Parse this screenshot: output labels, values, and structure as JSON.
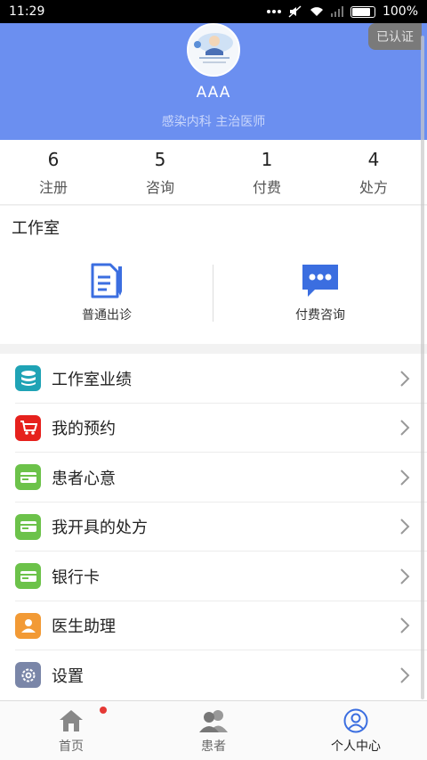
{
  "status_bar": {
    "time": "11:29",
    "battery": "100%"
  },
  "header": {
    "name": "AAA",
    "subtitle": "感染内科  主治医师",
    "verified": "已认证"
  },
  "stats": [
    {
      "num": "6",
      "label": "注册"
    },
    {
      "num": "5",
      "label": "咨询"
    },
    {
      "num": "1",
      "label": "付费"
    },
    {
      "num": "4",
      "label": "处方"
    }
  ],
  "studio": {
    "title": "工作室",
    "actions": [
      {
        "label": "普通出诊",
        "icon": "document-icon"
      },
      {
        "label": "付费咨询",
        "icon": "chat-icon"
      }
    ]
  },
  "menu": [
    {
      "label": "工作室业绩",
      "icon": "database-icon",
      "color": "#1fa3b5"
    },
    {
      "label": "我的预约",
      "icon": "cart-icon",
      "color": "#e6211d"
    },
    {
      "label": "患者心意",
      "icon": "card-icon",
      "color": "#6cc24a"
    },
    {
      "label": "我开具的处方",
      "icon": "card-icon",
      "color": "#6cc24a"
    },
    {
      "label": "银行卡",
      "icon": "card-icon",
      "color": "#6cc24a"
    },
    {
      "label": "医生助理",
      "icon": "person-icon",
      "color": "#f29a35"
    },
    {
      "label": "设置",
      "icon": "gear-icon",
      "color": "#7a86a8"
    }
  ],
  "tabbar": [
    {
      "label": "首页",
      "icon": "home-icon",
      "active": false
    },
    {
      "label": "患者",
      "icon": "patients-icon",
      "active": false
    },
    {
      "label": "个人中心",
      "icon": "profile-icon",
      "active": true
    }
  ],
  "colors": {
    "header_bg": "#6b8ff0",
    "accent_blue": "#3b6ee0",
    "badge_dot": "#e53935"
  }
}
